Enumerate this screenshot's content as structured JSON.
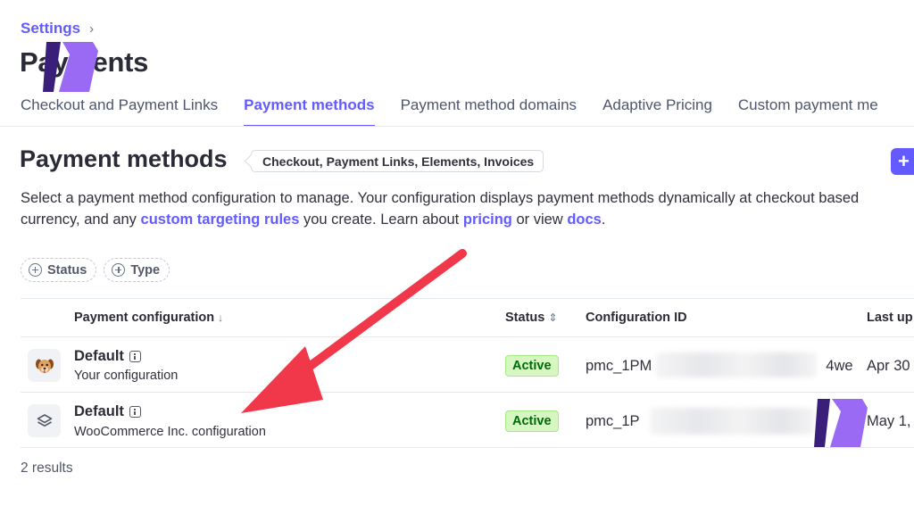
{
  "breadcrumb": {
    "parent": "Settings",
    "separator": "›"
  },
  "page": {
    "title": "Payments"
  },
  "tabs": [
    {
      "label": "Checkout and Payment Links",
      "active": false
    },
    {
      "label": "Payment methods",
      "active": true
    },
    {
      "label": "Payment method domains",
      "active": false
    },
    {
      "label": "Adaptive Pricing",
      "active": false
    },
    {
      "label": "Custom payment me",
      "active": false
    }
  ],
  "section": {
    "title": "Payment methods",
    "scope_badge": "Checkout, Payment Links, Elements, Invoices",
    "add_button_icon": "plus-icon",
    "add_button_label": "+"
  },
  "description": {
    "part1": "Select a payment method configuration to manage. Your configuration displays payment methods dynamically at checkout based",
    "part2": "currency, and any ",
    "link_targeting": "custom targeting rules",
    "part3": " you create. Learn about ",
    "link_pricing": "pricing",
    "part4": " or view ",
    "link_docs": "docs",
    "part5": "."
  },
  "filters": [
    {
      "label": "Status",
      "icon": "plus-circle-icon"
    },
    {
      "label": "Type",
      "icon": "plus-circle-icon"
    }
  ],
  "table": {
    "columns": {
      "configuration": "Payment configuration",
      "configuration_sort": "↓",
      "status": "Status",
      "status_sort": "⇕",
      "config_id": "Configuration ID",
      "last_updated": "Last up"
    },
    "rows": [
      {
        "icon": "dog-avatar-icon",
        "title": "Default",
        "subtitle": "Your configuration",
        "status": "Active",
        "config_id_prefix": "pmc_1PM",
        "config_id_suffix": "4we",
        "last_updated": "Apr 30"
      },
      {
        "icon": "layers-icon",
        "title": "Default",
        "subtitle": "WooCommerce Inc. configuration",
        "status": "Active",
        "config_id_prefix": "pmc_1P",
        "config_id_suffix": "",
        "last_updated": "May 1,"
      }
    ],
    "results_count": "2 results"
  },
  "colors": {
    "accent": "#635bff",
    "active_badge_bg": "#d7f7c2",
    "active_badge_text": "#006908",
    "annotation_arrow": "#f0384a",
    "watermark_dark": "#3a1f7a",
    "watermark_light": "#9b6af5"
  }
}
